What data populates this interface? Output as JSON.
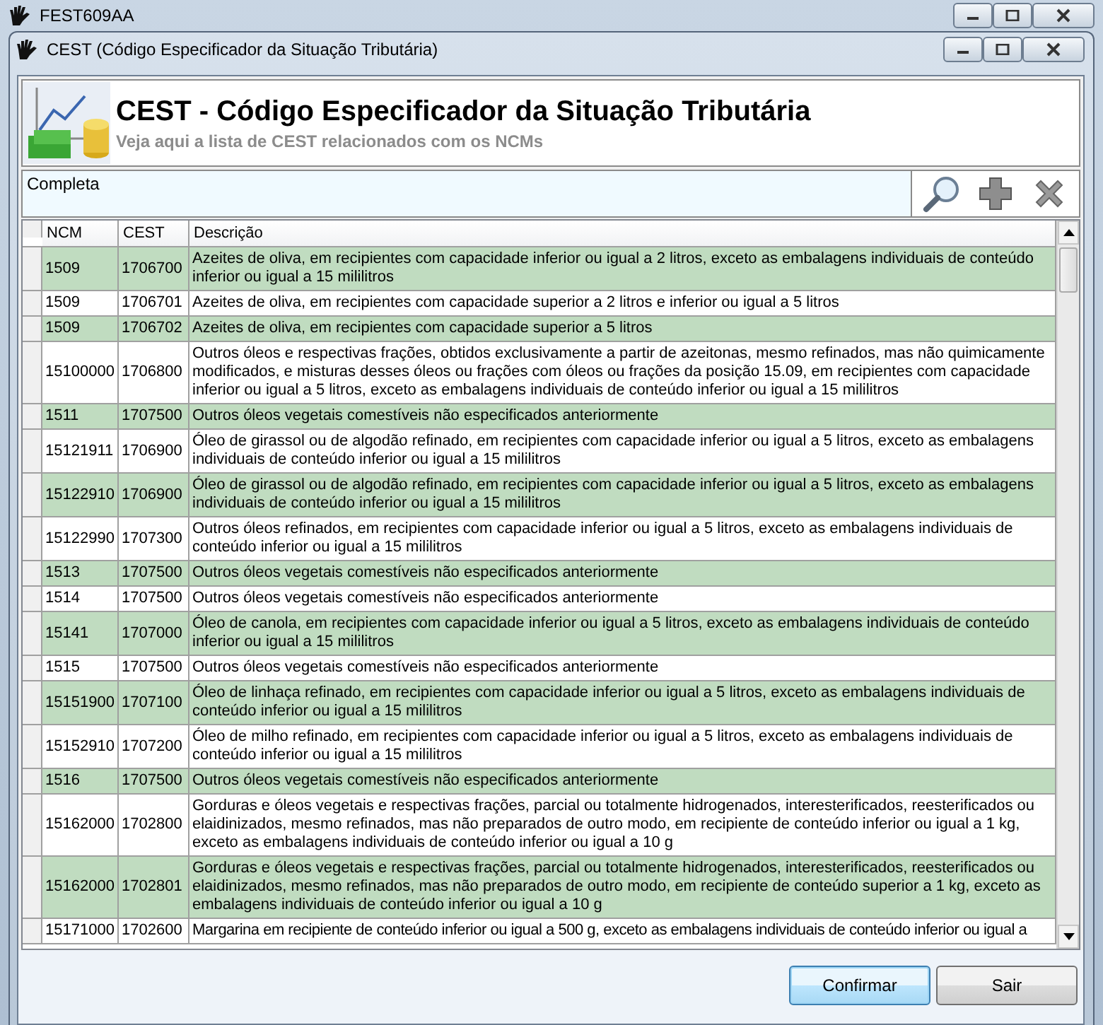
{
  "outer_window": {
    "title": "FEST609AA"
  },
  "window": {
    "title": "CEST (Código Especificador da Situação Tributária)"
  },
  "header": {
    "title": "CEST - Código Especificador da Situação Tributária",
    "subtitle": "Veja aqui a lista de CEST relacionados com os NCMs"
  },
  "filter": {
    "label": "Completa"
  },
  "table": {
    "columns": [
      "NCM",
      "CEST",
      "Descrição"
    ],
    "rows": [
      {
        "ncm": "1509",
        "cest": "1706700",
        "description": "Azeites de oliva, em recipientes com capacidade inferior ou igual a 2 litros, exceto as embalagens individuais de conteúdo inferior ou igual a 15 mililitros"
      },
      {
        "ncm": "1509",
        "cest": "1706701",
        "description": "Azeites de oliva, em recipientes com capacidade superior a 2 litros e inferior ou igual a 5 litros"
      },
      {
        "ncm": "1509",
        "cest": "1706702",
        "description": "Azeites de oliva, em recipientes com capacidade superior a 5 litros"
      },
      {
        "ncm": "15100000",
        "cest": "1706800",
        "description": "Outros óleos e respectivas frações, obtidos exclusivamente a partir de azeitonas, mesmo refinados, mas não quimicamente modificados, e misturas desses óleos ou frações com óleos ou frações da posição 15.09, em recipientes com capacidade inferior ou igual a 5 litros, exceto as embalagens individuais de conteúdo inferior ou igual a 15 mililitros"
      },
      {
        "ncm": "1511",
        "cest": "1707500",
        "description": "Outros óleos vegetais comestíveis não especificados anteriormente"
      },
      {
        "ncm": "15121911",
        "cest": "1706900",
        "description": "Óleo de girassol ou de algodão refinado, em recipientes com capacidade inferior ou igual a 5 litros, exceto as embalagens individuais de conteúdo inferior ou igual a 15 mililitros"
      },
      {
        "ncm": "15122910",
        "cest": "1706900",
        "description": "Óleo de girassol ou de algodão refinado, em recipientes com capacidade inferior ou igual a 5 litros, exceto as embalagens individuais de conteúdo inferior ou igual a 15 mililitros"
      },
      {
        "ncm": "15122990",
        "cest": "1707300",
        "description": "Outros óleos refinados, em recipientes com capacidade inferior ou igual a 5 litros, exceto as embalagens individuais de conteúdo inferior ou igual a 15 mililitros"
      },
      {
        "ncm": "1513",
        "cest": "1707500",
        "description": "Outros óleos vegetais comestíveis não especificados anteriormente"
      },
      {
        "ncm": "1514",
        "cest": "1707500",
        "description": "Outros óleos vegetais comestíveis não especificados anteriormente"
      },
      {
        "ncm": "15141",
        "cest": "1707000",
        "description": "Óleo de canola, em recipientes com capacidade inferior ou igual a 5 litros, exceto as embalagens individuais de conteúdo inferior ou igual a 15 mililitros"
      },
      {
        "ncm": "1515",
        "cest": "1707500",
        "description": "Outros óleos vegetais comestíveis não especificados anteriormente"
      },
      {
        "ncm": "15151900",
        "cest": "1707100",
        "description": "Óleo de linhaça refinado, em recipientes com capacidade inferior ou igual a 5 litros, exceto as embalagens individuais de conteúdo inferior ou igual a 15 mililitros"
      },
      {
        "ncm": "15152910",
        "cest": "1707200",
        "description": "Óleo de milho refinado, em recipientes com capacidade inferior ou igual a 5 litros, exceto as embalagens individuais de conteúdo inferior ou igual a 15 mililitros"
      },
      {
        "ncm": "1516",
        "cest": "1707500",
        "description": "Outros óleos vegetais comestíveis não especificados anteriormente"
      },
      {
        "ncm": "15162000",
        "cest": "1702800",
        "description": "Gorduras e óleos vegetais e respectivas frações, parcial ou totalmente hidrogenados, interesterificados, reesterificados ou elaidinizados, mesmo refinados, mas não preparados de outro modo, em recipiente de conteúdo inferior ou igual a 1 kg, exceto as embalagens individuais de conteúdo inferior ou igual a 10 g"
      },
      {
        "ncm": "15162000",
        "cest": "1702801",
        "description": "Gorduras e óleos vegetais e respectivas frações, parcial ou totalmente hidrogenados, interesterificados, reesterificados ou elaidinizados, mesmo refinados, mas não preparados de outro modo, em recipiente de conteúdo superior a 1 kg, exceto as embalagens individuais de conteúdo inferior ou igual a 10 g"
      },
      {
        "ncm": "15171000",
        "cest": "1702600",
        "description": "Margarina em recipiente de conteúdo inferior ou igual a 500 g, exceto as embalagens individuais de conteúdo inferior ou igual a"
      }
    ]
  },
  "buttons": [
    {
      "label": "Confirmar",
      "default": true
    },
    {
      "label": "Sair",
      "default": false
    }
  ]
}
